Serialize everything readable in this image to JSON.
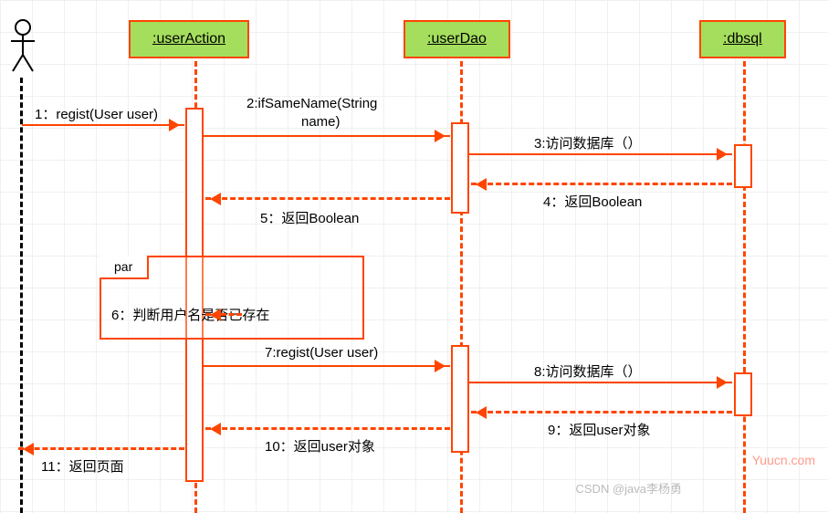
{
  "participants": {
    "userAction": ":userAction",
    "userDao": ":userDao",
    "dbsql": ":dbsql"
  },
  "fragment": {
    "label": "par",
    "note": "6：判断用户名是否已存在"
  },
  "messages": {
    "m1": "1：regist(User user)",
    "m2_a": "2:ifSameName(String",
    "m2_b": "name)",
    "m3": "3:访问数据库（）",
    "m4": "4：返回Boolean",
    "m5": "5：返回Boolean",
    "m7": "7:regist(User user)",
    "m8": "8:访问数据库（）",
    "m9": "9：返回user对象",
    "m10": "10：返回user对象",
    "m11": "11：返回页面"
  },
  "watermark": "Yuucn.com",
  "credit": "CSDN @java李杨勇",
  "chart_data": {
    "type": "sequence-diagram",
    "participants": [
      "Actor",
      ":userAction",
      ":userDao",
      ":dbsql"
    ],
    "messages": [
      {
        "n": 1,
        "from": "Actor",
        "to": ":userAction",
        "label": "regist(User user)",
        "kind": "sync"
      },
      {
        "n": 2,
        "from": ":userAction",
        "to": ":userDao",
        "label": "ifSameName(String name)",
        "kind": "sync"
      },
      {
        "n": 3,
        "from": ":userDao",
        "to": ":dbsql",
        "label": "访问数据库（）",
        "kind": "sync"
      },
      {
        "n": 4,
        "from": ":dbsql",
        "to": ":userDao",
        "label": "返回Boolean",
        "kind": "return"
      },
      {
        "n": 5,
        "from": ":userDao",
        "to": ":userAction",
        "label": "返回Boolean",
        "kind": "return"
      },
      {
        "n": 6,
        "fragment": "par",
        "label": "判断用户名是否已存在"
      },
      {
        "n": 7,
        "from": ":userAction",
        "to": ":userDao",
        "label": "regist(User user)",
        "kind": "sync"
      },
      {
        "n": 8,
        "from": ":userDao",
        "to": ":dbsql",
        "label": "访问数据库（）",
        "kind": "sync"
      },
      {
        "n": 9,
        "from": ":dbsql",
        "to": ":userDao",
        "label": "返回user对象",
        "kind": "return"
      },
      {
        "n": 10,
        "from": ":userDao",
        "to": ":userAction",
        "label": "返回user对象",
        "kind": "return"
      },
      {
        "n": 11,
        "from": ":userAction",
        "to": "Actor",
        "label": "返回页面",
        "kind": "return"
      }
    ]
  }
}
